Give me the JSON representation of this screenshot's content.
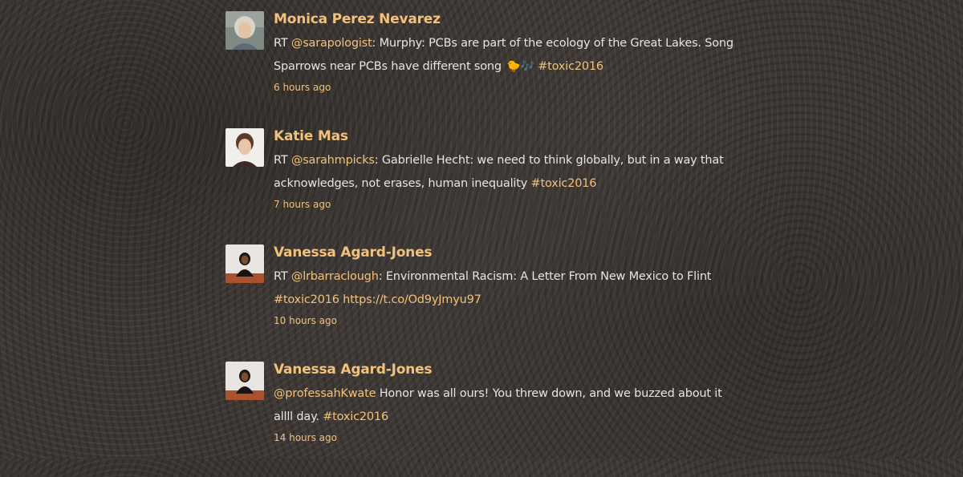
{
  "tweets": [
    {
      "name": "Monica Perez Nevarez",
      "avatar_icon": "avatar-monica",
      "segments": [
        {
          "text": "RT ",
          "link": false
        },
        {
          "text": "@sarapologist",
          "link": true
        },
        {
          "text": ": Murphy: PCBs are part of the ecology of the Great Lakes. Song Sparrows near PCBs have different song ",
          "link": false
        },
        {
          "text": "🐤🎶",
          "link": false
        },
        {
          "text": " ",
          "link": false
        },
        {
          "text": "#toxic2016",
          "link": true
        }
      ],
      "time": "6 hours ago"
    },
    {
      "name": "Katie Mas",
      "avatar_icon": "avatar-katie",
      "segments": [
        {
          "text": "RT ",
          "link": false
        },
        {
          "text": "@sarahmpicks",
          "link": true
        },
        {
          "text": ": Gabrielle Hecht: we need to think globally, but in a way that acknowledges, not erases, human inequality ",
          "link": false
        },
        {
          "text": "#toxic2016",
          "link": true
        }
      ],
      "time": "7 hours ago"
    },
    {
      "name": "Vanessa Agard-Jones",
      "avatar_icon": "avatar-vanessa",
      "segments": [
        {
          "text": "RT ",
          "link": false
        },
        {
          "text": "@lrbarraclough",
          "link": true
        },
        {
          "text": ": Environmental Racism: A Letter From New Mexico to Flint ",
          "link": false
        },
        {
          "text": "#toxic2016",
          "link": true
        },
        {
          "text": " ",
          "link": false
        },
        {
          "text": "https://t.co/Od9yJmyu97",
          "link": true
        }
      ],
      "time": "10 hours ago"
    },
    {
      "name": "Vanessa Agard-Jones",
      "avatar_icon": "avatar-vanessa",
      "segments": [
        {
          "text": "@professahKwate",
          "link": true
        },
        {
          "text": " Honor was all ours! You threw down, and we buzzed about it allll day. ",
          "link": false
        },
        {
          "text": "#toxic2016",
          "link": true
        }
      ],
      "time": "14 hours ago"
    }
  ],
  "colors": {
    "accent": "#f2c27d",
    "text": "#e9e4de",
    "background": "#3a3531"
  }
}
